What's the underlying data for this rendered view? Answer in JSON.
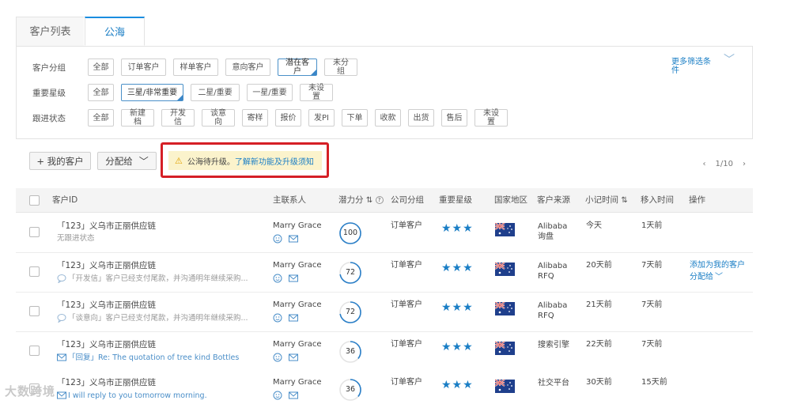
{
  "tabs": [
    {
      "label": "客户列表",
      "active": false
    },
    {
      "label": "公海",
      "active": true
    }
  ],
  "filters": {
    "group": {
      "label": "客户分组",
      "options": [
        "全部",
        "订单客户",
        "样单客户",
        "意向客户",
        "潜在客户",
        "未分组"
      ],
      "selected": "潜在客户"
    },
    "star": {
      "label": "重要星级",
      "options": [
        "全部",
        "三星/非常重要",
        "二星/重要",
        "一星/重要",
        "未设置"
      ],
      "selected": "三星/非常重要"
    },
    "status": {
      "label": "跟进状态",
      "options": [
        "全部",
        "新建档",
        "开发信",
        "谈意向",
        "寄样",
        "报价",
        "发PI",
        "下单",
        "收款",
        "出货",
        "售后",
        "未设置"
      ]
    },
    "more": "更多筛选条件"
  },
  "toolbar": {
    "my_customers": "+ 我的客户",
    "assign": "分配给",
    "notice_text": "公海待升级。",
    "notice_link": "了解新功能及升级须知",
    "pager": "1/10"
  },
  "columns": [
    "客户ID",
    "主联系人",
    "潜力分",
    "公司分组",
    "重要星级",
    "国家地区",
    "客户来源",
    "小记时间",
    "移入时间",
    "操作"
  ],
  "rows": [
    {
      "name": "「123」义乌市正丽供应链",
      "note": "无跟进状态",
      "note_type": "plain",
      "contact": "Marry Grace",
      "score": 100,
      "group": "订单客户",
      "stars": "★★★",
      "source1": "Alibaba",
      "source2": "询盘",
      "note_time": "今天",
      "move_time": "1天前",
      "ops": []
    },
    {
      "name": "「123」义乌市正丽供应链",
      "note": "「开发信」客户已经支付尾款，并沟通明年继续采购...",
      "note_type": "chat",
      "contact": "Marry Grace",
      "score": 72,
      "group": "订单客户",
      "stars": "★★★",
      "source1": "Alibaba",
      "source2": "RFQ",
      "note_time": "20天前",
      "move_time": "7天前",
      "ops": [
        "添加为我的客户",
        "分配给"
      ]
    },
    {
      "name": "「123」义乌市正丽供应链",
      "note": "「谈意向」客户已经支付尾款，并沟通明年继续采购...",
      "note_type": "chat",
      "contact": "Marry Grace",
      "score": 72,
      "group": "订单客户",
      "stars": "★★★",
      "source1": "Alibaba",
      "source2": "RFQ",
      "note_time": "21天前",
      "move_time": "7天前",
      "ops": []
    },
    {
      "name": "「123」义乌市正丽供应链",
      "note": "「回复」Re: The quotation of tree kind Bottles",
      "note_type": "mail",
      "contact": "Marry Grace",
      "score": 36,
      "group": "订单客户",
      "stars": "★★★",
      "source1": "搜索引擎",
      "source2": "",
      "note_time": "22天前",
      "move_time": "7天前",
      "ops": []
    },
    {
      "name": "「123」义乌市正丽供应链",
      "note": "I will reply to you tomorrow morning.",
      "note_type": "mail",
      "contact": "Marry Grace",
      "score": 36,
      "group": "订单客户",
      "stars": "★★★",
      "source1": "社交平台",
      "source2": "",
      "note_time": "30天前",
      "move_time": "15天前",
      "ops": []
    }
  ],
  "watermark": "大数跨境",
  "colors": {
    "accent": "#1a7ec5",
    "highlight": "#d51f26",
    "notice_bg": "#fbf3cc"
  }
}
